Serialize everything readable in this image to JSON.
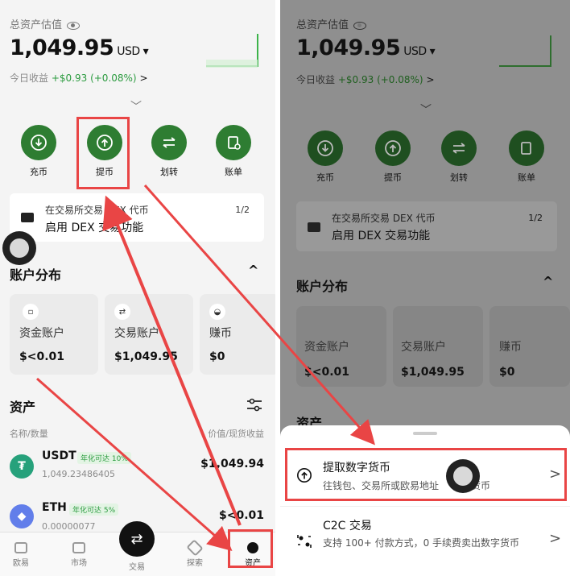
{
  "header": {
    "total_label": "总资产估值",
    "balance": "1,049.95",
    "currency": "USD ▾",
    "pnl_label": "今日收益",
    "pnl_value": "+$0.93 (+0.08%)",
    "pnl_chevron": ">"
  },
  "actions": [
    {
      "label": "充币",
      "icon": "download-icon"
    },
    {
      "label": "提币",
      "icon": "upload-icon"
    },
    {
      "label": "划转",
      "icon": "transfer-icon"
    },
    {
      "label": "账单",
      "icon": "bill-icon"
    }
  ],
  "banner": {
    "line1": "在交易所交易 DEX 代币",
    "line2": "启用 DEX 交易功能",
    "pager": "1/2"
  },
  "distribution": {
    "title": "账户分布",
    "toggle": "^",
    "cards": [
      {
        "name": "资金账户",
        "value": "$<0.01"
      },
      {
        "name": "交易账户",
        "value": "$1,049.95"
      },
      {
        "name": "赚币",
        "value": "$0"
      }
    ],
    "cards_right": [
      {
        "name": "资金账户",
        "value": "$<0.01"
      },
      {
        "name": "交易账户",
        "value": "$1,049.95"
      },
      {
        "name": "赚币",
        "value": "$0"
      }
    ]
  },
  "assets": {
    "title": "资产",
    "col_left": "名称/数量",
    "col_right": "价值/现货收益",
    "rows": [
      {
        "symbol": "USDT",
        "tag": "年化可达 10%",
        "amount": "1,049.23486405",
        "value": "$1,049.94",
        "color": "#26a17b",
        "glyph": "₮"
      },
      {
        "symbol": "ETH",
        "tag": "年化可达 5%",
        "amount": "0.00000077",
        "value": "$<0.01",
        "color": "#627eea",
        "glyph": "◆"
      }
    ]
  },
  "nav": {
    "items": [
      {
        "label": "欧易",
        "icon": "grid-icon"
      },
      {
        "label": "市场",
        "icon": "chart-icon"
      },
      {
        "label": "交易",
        "icon": "swap-icon"
      },
      {
        "label": "探索",
        "icon": "compass-icon"
      },
      {
        "label": "资产",
        "icon": "pie-icon"
      }
    ],
    "trade_glyph": "⇄"
  },
  "sheet": {
    "items": [
      {
        "title": "提取数字货币",
        "subtitle": "往钱包、交易所或欧易地址",
        "subtitle_tail": "字货币",
        "icon": "upload-icon"
      },
      {
        "title": "C2C 交易",
        "subtitle": "支持 100+ 付款方式，0 手续费卖出数字货币",
        "icon": "c2c-icon"
      }
    ],
    "chevron": ">"
  },
  "colors": {
    "accent_green": "#2e7d32",
    "highlight_red": "#e94545",
    "positive": "#2b9b3f"
  }
}
